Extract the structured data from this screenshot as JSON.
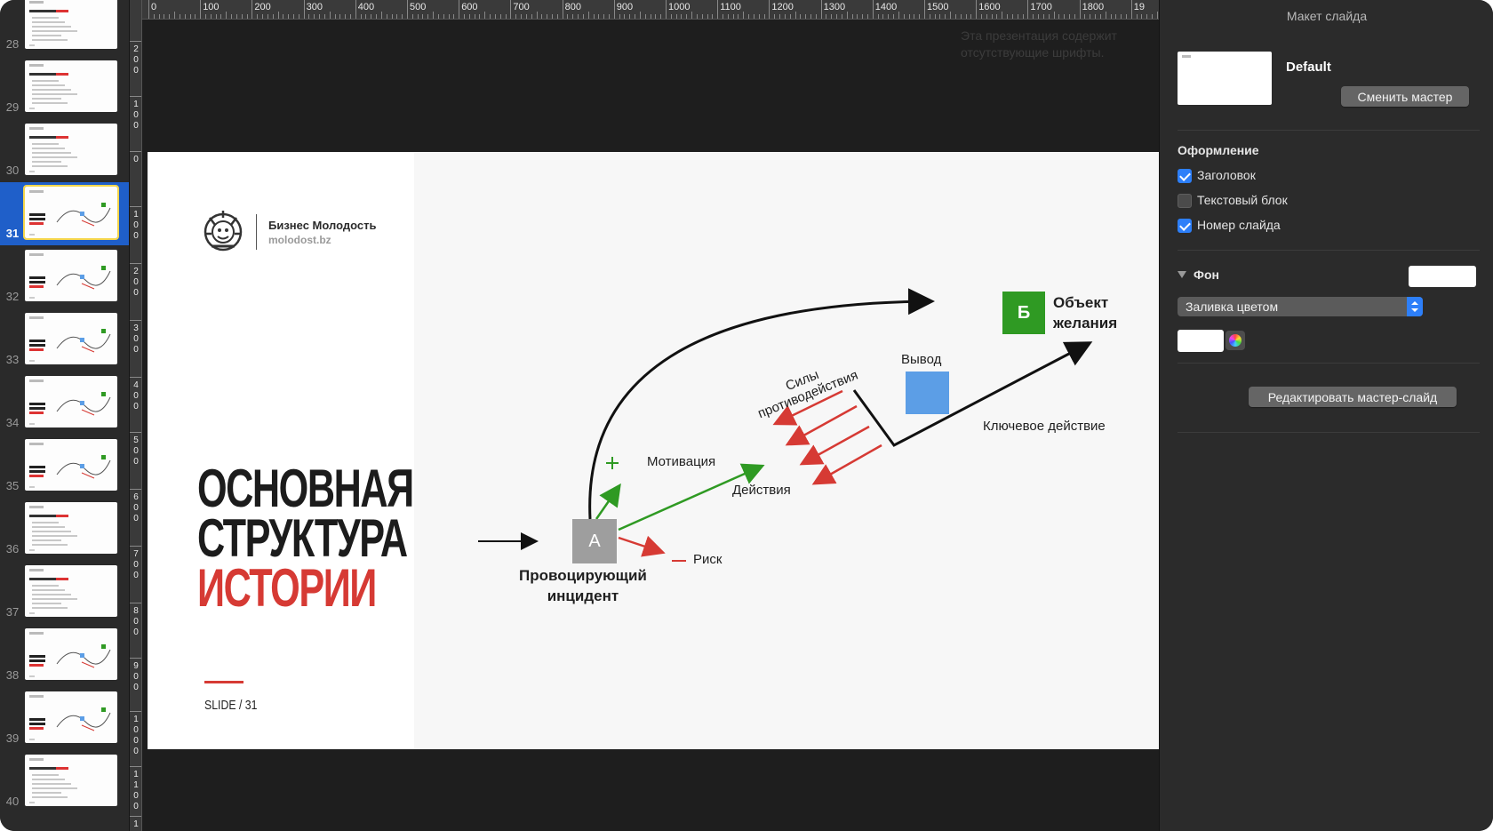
{
  "navigator": {
    "slides": [
      {
        "number": "28"
      },
      {
        "number": "29"
      },
      {
        "number": "30"
      },
      {
        "number": "31",
        "selected": true
      },
      {
        "number": "32"
      },
      {
        "number": "33"
      },
      {
        "number": "34"
      },
      {
        "number": "35"
      },
      {
        "number": "36"
      },
      {
        "number": "37"
      },
      {
        "number": "38"
      },
      {
        "number": "39"
      },
      {
        "number": "40"
      }
    ]
  },
  "ruler": {
    "horizontal_labels": [
      "0",
      "100",
      "200",
      "300",
      "400",
      "500",
      "600",
      "700",
      "800",
      "900",
      "1000",
      "1100",
      "1200",
      "1300",
      "1400",
      "1500",
      "1600",
      "1700",
      "1800",
      "19"
    ],
    "vertical_labels": [
      "2\n0\n0",
      "1\n0\n0",
      "0",
      "1\n0\n0",
      "2\n0\n0",
      "3\n0\n0",
      "4\n0\n0",
      "5\n0\n0",
      "6\n0\n0",
      "7\n0\n0",
      "8\n0\n0",
      "9\n0\n0",
      "1\n0\n0\n0",
      "1\n1\n0\n0",
      "1"
    ]
  },
  "canvas": {
    "warning": "Эта презентация содержит отсутствующие шрифты."
  },
  "slide": {
    "brand_name": "Бизнес Молодость",
    "brand_url": "molodost.bz",
    "title_line1": "ОСНОВНАЯ",
    "title_line2": "СТРУКТУРА",
    "title_line3": "ИСТОРИИ",
    "slide_number": "SLIDE  / 31",
    "diagram": {
      "box_a": "А",
      "box_b": "Б",
      "incident": "Провоцирующий\nинцидент",
      "motivation": "Мотивация",
      "actions": "Действия",
      "risk": "Риск",
      "forces": "Силы\nпротиводействия",
      "conclusion": "Вывод",
      "key_action": "Ключевое действие",
      "object": "Объект\nжелания"
    },
    "colors": {
      "accent_red": "#d63a34",
      "green": "#2f9a23",
      "blue": "#5c9ee6",
      "grey_box": "#9e9e9e"
    }
  },
  "inspector": {
    "title": "Макет слайда",
    "master_name": "Default",
    "change_master": "Сменить мастер",
    "appearance_label": "Оформление",
    "checkboxes": [
      {
        "label": "Заголовок",
        "checked": true
      },
      {
        "label": "Текстовый блок",
        "checked": false
      },
      {
        "label": "Номер слайда",
        "checked": true
      }
    ],
    "background_label": "Фон",
    "fill_type": "Заливка цветом",
    "edit_master": "Редактировать мастер-слайд",
    "icons": [
      "chevron-down-icon",
      "color-wheel-icon",
      "select-arrows-icon"
    ]
  }
}
